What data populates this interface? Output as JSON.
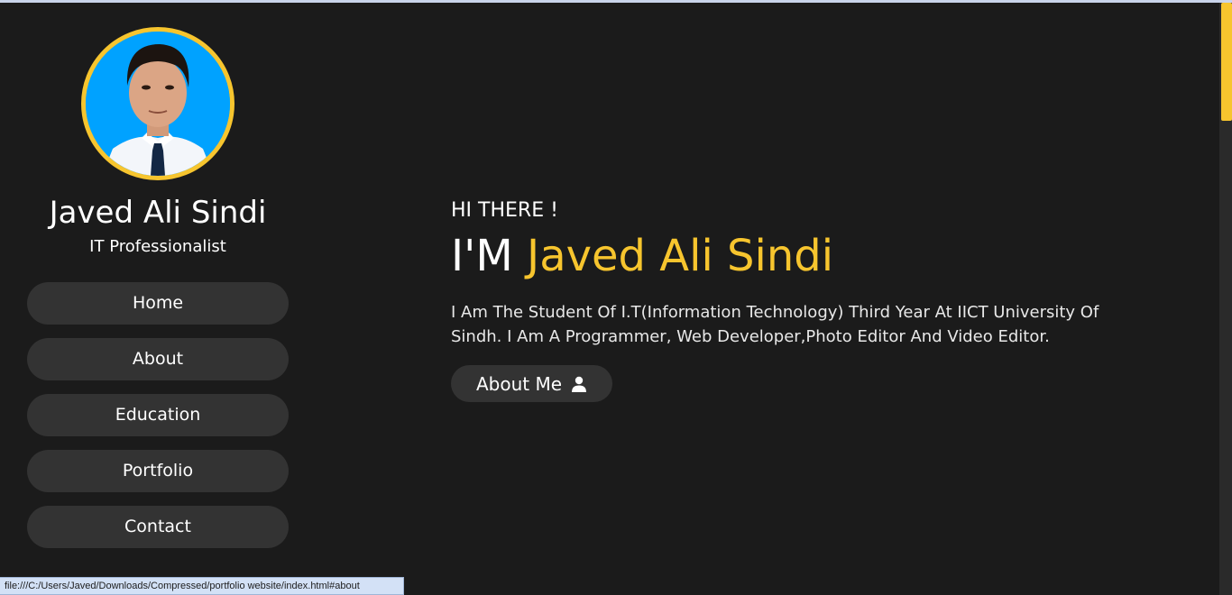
{
  "colors": {
    "accent": "#f7c52e",
    "background": "#1b1b1b",
    "button": "#333333"
  },
  "sidebar": {
    "name": "Javed Ali Sindi",
    "role": "IT Professionalist",
    "nav": [
      {
        "label": "Home"
      },
      {
        "label": "About"
      },
      {
        "label": "Education"
      },
      {
        "label": "Portfolio"
      },
      {
        "label": "Contact"
      }
    ]
  },
  "main": {
    "greeting": "HI THERE !",
    "headline_prefix": "I'M ",
    "headline_name": "Javed Ali Sindi",
    "intro": "I Am The Student Of I.T(Information Technology) Third Year At IICT University Of Sindh. I Am A Programmer, Web Developer,Photo Editor And Video Editor.",
    "button_label": "About Me",
    "button_icon": "user-icon"
  },
  "status_bar": {
    "url": "file:///C:/Users/Javed/Downloads/Compressed/portfolio website/index.html#about"
  }
}
